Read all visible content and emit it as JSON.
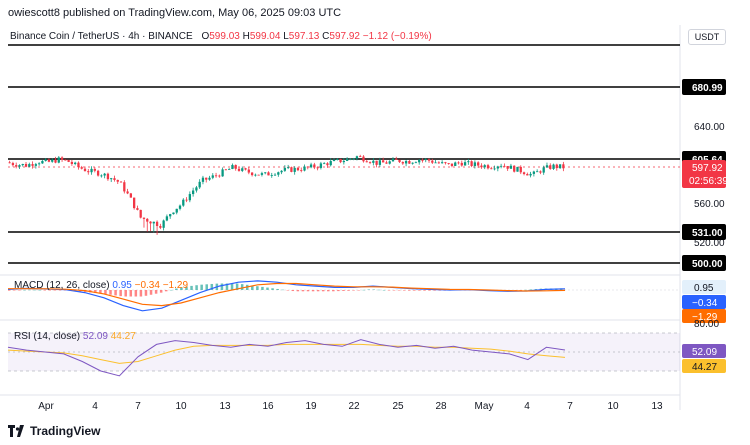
{
  "header": {
    "text": "owiescott8 published on TradingView.com, May 06, 2025 09:03 UTC"
  },
  "symbol": {
    "name": "Binance Coin / TetherUS · 4h · BINANCE",
    "o_label": "O",
    "o": "599.03",
    "h_label": "H",
    "h": "599.04",
    "l_label": "L",
    "l": "597.13",
    "c_label": "C",
    "c": "597.92",
    "change": "−1.12 (−0.19%)"
  },
  "currency": "USDT",
  "price_axis": {
    "ticks": [
      "640.00",
      "560.00",
      "520.00"
    ],
    "level_labels": [
      "680.99",
      "605.64",
      "531.00",
      "500.00"
    ],
    "current_price": "597.92",
    "countdown": "02:56:39"
  },
  "x_axis": {
    "ticks": [
      "Apr",
      "4",
      "7",
      "10",
      "13",
      "16",
      "19",
      "22",
      "25",
      "28",
      "May",
      "4",
      "7",
      "10",
      "13"
    ]
  },
  "macd": {
    "label": "MACD (12, 26, close)",
    "macd_value": "0.95",
    "signal_value": "−0.34",
    "hist_value": "−1.29",
    "axis_labels": [
      "0.95",
      "−0.34",
      "−1.29"
    ]
  },
  "rsi": {
    "label": "RSI (14, close)",
    "rsi_value": "52.09",
    "ma_value": "44.27",
    "axis_top": "80.00",
    "axis_labels": [
      "52.09",
      "44.27"
    ]
  },
  "footer": {
    "brand": "TradingView"
  },
  "colors": {
    "up": "#089981",
    "down": "#f23645",
    "macd": "#2962ff",
    "signal": "#ff6d00",
    "rsi": "#7e57c2",
    "rsi_ma": "#fbc02d",
    "level": "#000000"
  },
  "chart_data": {
    "type": "candlestick",
    "title": "Binance Coin / TetherUS · 4h · BINANCE",
    "timeframe": "4h",
    "x_range": [
      "2025-03-31",
      "2025-05-14"
    ],
    "ylim": [
      510,
      700
    ],
    "horizontal_levels": [
      680.99,
      605.64,
      531.0,
      500.0
    ],
    "close_path": [
      [
        0,
        603
      ],
      [
        1,
        601
      ],
      [
        2,
        600
      ],
      [
        3,
        604
      ],
      [
        4,
        603
      ],
      [
        5,
        606
      ],
      [
        6,
        604
      ],
      [
        7,
        598
      ],
      [
        8,
        594
      ],
      [
        9,
        592
      ],
      [
        10,
        588
      ],
      [
        11,
        582
      ],
      [
        12,
        566
      ],
      [
        13,
        546
      ],
      [
        14,
        542
      ],
      [
        15,
        538
      ],
      [
        16,
        552
      ],
      [
        17,
        560
      ],
      [
        18,
        573
      ],
      [
        19,
        584
      ],
      [
        20,
        588
      ],
      [
        21,
        593
      ],
      [
        22,
        598
      ],
      [
        23,
        594
      ],
      [
        24,
        592
      ],
      [
        25,
        590
      ],
      [
        26,
        593
      ],
      [
        27,
        595
      ],
      [
        28,
        596
      ],
      [
        29,
        597
      ],
      [
        30,
        599
      ],
      [
        31,
        602
      ],
      [
        32,
        604
      ],
      [
        33,
        606
      ],
      [
        34,
        609
      ],
      [
        35,
        606
      ],
      [
        36,
        602
      ],
      [
        37,
        603
      ],
      [
        38,
        605
      ],
      [
        39,
        604
      ],
      [
        40,
        606
      ],
      [
        41,
        605
      ],
      [
        42,
        602
      ],
      [
        43,
        600
      ],
      [
        44,
        603
      ],
      [
        45,
        601
      ],
      [
        46,
        600
      ],
      [
        47,
        599
      ],
      [
        48,
        601
      ],
      [
        49,
        597
      ],
      [
        50,
        594
      ],
      [
        51,
        590
      ],
      [
        52,
        596
      ],
      [
        53,
        599
      ],
      [
        54,
        598
      ]
    ],
    "macd_values": [
      0.5,
      1.2,
      0.8,
      0.2,
      -2,
      -6,
      -12,
      -16,
      -14,
      -8,
      -2,
      3,
      6,
      7,
      6,
      4,
      3,
      2,
      2,
      3,
      2,
      1,
      0.5,
      0,
      0.3,
      -0.5,
      -1,
      -0.8,
      0.5,
      0.95
    ],
    "signal_values": [
      1,
      1,
      0.9,
      0.6,
      -0.5,
      -3,
      -7,
      -11,
      -12,
      -10,
      -6,
      -2,
      1,
      4,
      5,
      5,
      4,
      3,
      2.5,
      2.5,
      2.2,
      1.5,
      1,
      0.5,
      0.4,
      0,
      -0.5,
      -0.8,
      -0.6,
      -0.34
    ],
    "rsi_values": [
      55,
      52,
      50,
      48,
      40,
      30,
      25,
      45,
      58,
      62,
      60,
      57,
      55,
      58,
      56,
      60,
      62,
      58,
      56,
      63,
      58,
      55,
      57,
      54,
      56,
      52,
      50,
      48,
      42,
      55,
      52.09
    ],
    "rsi_ma_values": [
      52,
      51,
      50,
      49,
      46,
      42,
      38,
      40,
      46,
      52,
      56,
      57,
      57,
      57,
      57,
      58,
      58,
      58,
      58,
      58,
      57,
      56,
      56,
      55,
      55,
      54,
      53,
      51,
      48,
      46,
      44.27
    ]
  }
}
